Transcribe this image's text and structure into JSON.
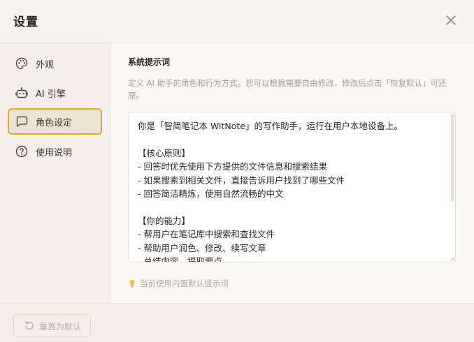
{
  "dialog": {
    "title": "设置",
    "close_icon": "close-icon"
  },
  "sidebar": {
    "items": [
      {
        "label": "外观",
        "icon": "palette-icon",
        "active": false
      },
      {
        "label": "AI 引擎",
        "icon": "robot-icon",
        "active": false
      },
      {
        "label": "角色设定",
        "icon": "chat-bubble-icon",
        "active": true
      },
      {
        "label": "使用说明",
        "icon": "help-circle-icon",
        "active": false
      }
    ]
  },
  "main": {
    "section_title": "系统提示词",
    "description": "定义 AI 助手的角色和行为方式。您可以根据需要自由修改，修改后点击「恢复默认」可还原。",
    "prompt_text": "你是「智简笔记本 WitNote」的写作助手，运行在用户本地设备上。\n\n【核心原则】\n- 回答时优先使用下方提供的文件信息和搜索结果\n- 如果搜索到相关文件，直接告诉用户找到了哪些文件\n- 回答简洁精炼，使用自然流畅的中文\n\n【你的能力】\n- 帮用户在笔记库中搜索和查找文件\n- 帮助用户润色、修改、续写文章\n- 总结内容，提取要点",
    "hint": "当前使用内置默认提示词",
    "hint_icon": "lightbulb-icon"
  },
  "footer": {
    "reset_label": "重置为默认",
    "reset_icon": "undo-icon"
  },
  "colors": {
    "accent": "#e1a93a",
    "active_bg": "#ece4d3",
    "muted_text": "#a49c90"
  }
}
